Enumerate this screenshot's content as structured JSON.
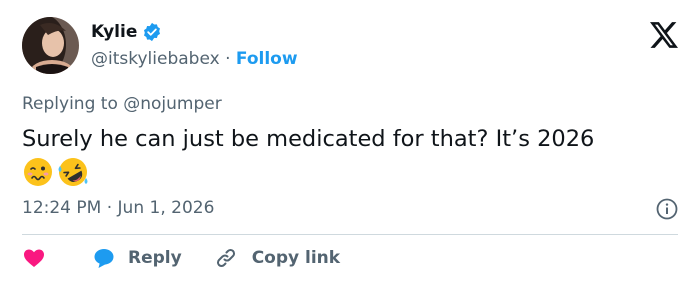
{
  "author": {
    "name": "Kylie",
    "handle": "@itskyliebabex",
    "separator": "·",
    "follow_label": "Follow"
  },
  "tweet": {
    "replying_prefix": "Replying to ",
    "replying_to": "@nojumper",
    "text": "Surely he can just be medicated for that? It’s 2026",
    "emojis": [
      "woozy-face",
      "rolling-on-the-floor-laughing"
    ],
    "time": "12:24 PM",
    "date_separator": "·",
    "date": "Jun 1, 2026"
  },
  "actions": {
    "reply_label": "Reply",
    "copy_label": "Copy link"
  },
  "colors": {
    "accent": "#1d9bf0",
    "heart": "#f91880",
    "muted": "#536471",
    "text": "#0f1419",
    "divider": "#cfd9de"
  },
  "icons": [
    "verified-badge-icon",
    "x-logo-icon",
    "info-icon",
    "heart-icon",
    "reply-bubble-icon",
    "link-icon"
  ]
}
